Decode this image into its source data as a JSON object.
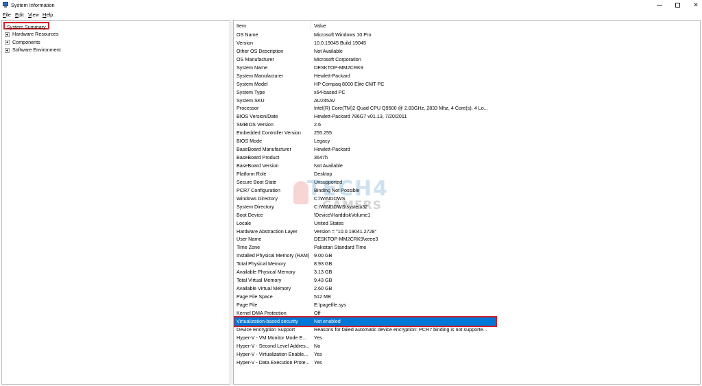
{
  "window": {
    "title": "System Information",
    "controls": {
      "minimize": "minimize",
      "maximize": "maximize",
      "close": "✕"
    }
  },
  "menu": [
    {
      "mnemonic": "F",
      "rest": "ile"
    },
    {
      "mnemonic": "E",
      "rest": "dit"
    },
    {
      "mnemonic": "V",
      "rest": "iew"
    },
    {
      "mnemonic": "H",
      "rest": "elp"
    }
  ],
  "tree": {
    "root": "System Summary",
    "children": [
      "Hardware Resources",
      "Components",
      "Software Environment"
    ]
  },
  "list": {
    "columns": {
      "item": "Item",
      "value": "Value"
    },
    "selected_index": 35,
    "rows": [
      {
        "item": "OS Name",
        "value": "Microsoft Windows 10 Pro"
      },
      {
        "item": "Version",
        "value": "10.0.19045 Build 19045"
      },
      {
        "item": "Other OS Description",
        "value": "Not Available"
      },
      {
        "item": "OS Manufacturer",
        "value": "Microsoft Corporation"
      },
      {
        "item": "System Name",
        "value": "DESKTOP-MM2CRK9"
      },
      {
        "item": "System Manufacturer",
        "value": "Hewlett-Packard"
      },
      {
        "item": "System Model",
        "value": "HP Compaq 8000 Elite CMT PC"
      },
      {
        "item": "System Type",
        "value": "x64-based PC"
      },
      {
        "item": "System SKU",
        "value": "AU245AV"
      },
      {
        "item": "Processor",
        "value": "Intel(R) Core(TM)2 Quad CPU    Q9500  @ 2.83GHz, 2833 Mhz, 4 Core(s), 4 Lo..."
      },
      {
        "item": "BIOS Version/Date",
        "value": "Hewlett-Packard 786G7 v01.13, 7/20/2011"
      },
      {
        "item": "SMBIOS Version",
        "value": "2.6"
      },
      {
        "item": "Embedded Controller Version",
        "value": "255.255"
      },
      {
        "item": "BIOS Mode",
        "value": "Legacy"
      },
      {
        "item": "BaseBoard Manufacturer",
        "value": "Hewlett-Packard"
      },
      {
        "item": "BaseBoard Product",
        "value": "3647h"
      },
      {
        "item": "BaseBoard Version",
        "value": "Not Available"
      },
      {
        "item": "Platform Role",
        "value": "Desktop"
      },
      {
        "item": "Secure Boot State",
        "value": "Unsupported"
      },
      {
        "item": "PCR7 Configuration",
        "value": "Binding Not Possible"
      },
      {
        "item": "Windows Directory",
        "value": "C:\\WINDOWS"
      },
      {
        "item": "System Directory",
        "value": "C:\\WINDOWS\\system32"
      },
      {
        "item": "Boot Device",
        "value": "\\Device\\HarddiskVolume1"
      },
      {
        "item": "Locale",
        "value": "United States"
      },
      {
        "item": "Hardware Abstraction Layer",
        "value": "Version = \"10.0.19041.2728\""
      },
      {
        "item": "User Name",
        "value": "DESKTOP-MM2CRK9\\xeee3"
      },
      {
        "item": "Time Zone",
        "value": "Pakistan Standard Time"
      },
      {
        "item": "Installed Physical Memory (RAM)",
        "value": "9.00 GB"
      },
      {
        "item": "Total Physical Memory",
        "value": "8.93 GB"
      },
      {
        "item": "Available Physical Memory",
        "value": "3.13 GB"
      },
      {
        "item": "Total Virtual Memory",
        "value": "9.43 GB"
      },
      {
        "item": "Available Virtual Memory",
        "value": "2.60 GB"
      },
      {
        "item": "Page File Space",
        "value": "512 MB"
      },
      {
        "item": "Page File",
        "value": "E:\\pagefile.sys"
      },
      {
        "item": "Kernel DMA Protection",
        "value": "Off"
      },
      {
        "item": "Virtualization-based security",
        "value": "Not enabled"
      },
      {
        "item": "Device Encryption Support",
        "value": "Reasons for failed automatic device encryption: PCR7 binding is not supporte..."
      },
      {
        "item": "Hyper-V - VM Monitor Mode E...",
        "value": "Yes"
      },
      {
        "item": "Hyper-V - Second Level Addres...",
        "value": "No"
      },
      {
        "item": "Hyper-V - Virtualization Enable...",
        "value": "Yes"
      },
      {
        "item": "Hyper-V - Data Execution Prote...",
        "value": "Yes"
      }
    ]
  },
  "watermark": {
    "line1": "TECH4",
    "line2": "GAMERS"
  },
  "colors": {
    "selection": "#0078d7",
    "highlight_box": "#d11f28"
  }
}
